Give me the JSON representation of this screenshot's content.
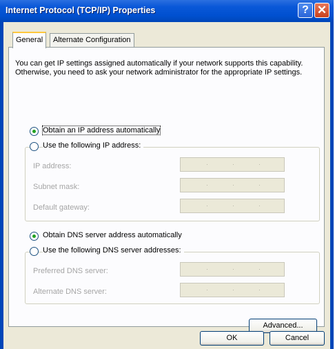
{
  "window": {
    "title": "Internet Protocol (TCP/IP) Properties",
    "help_glyph": "?",
    "close_glyph": "✕"
  },
  "tabs": [
    {
      "label": "General",
      "selected": true
    },
    {
      "label": "Alternate Configuration",
      "selected": false
    }
  ],
  "description": "You can get IP settings assigned automatically if your network supports this capability. Otherwise, you need to ask your network administrator for the appropriate IP settings.",
  "ip_section": {
    "obtain_auto": {
      "label": "Obtain an IP address automatically",
      "checked": true
    },
    "use_following": {
      "label": "Use the following IP address:",
      "checked": false
    },
    "fields": [
      {
        "label": "IP address:"
      },
      {
        "label": "Subnet mask:"
      },
      {
        "label": "Default gateway:"
      }
    ]
  },
  "dns_section": {
    "obtain_auto": {
      "label": "Obtain DNS server address automatically",
      "checked": true
    },
    "use_following": {
      "label": "Use the following DNS server addresses:",
      "checked": false
    },
    "fields": [
      {
        "label": "Preferred DNS server:"
      },
      {
        "label": "Alternate DNS server:"
      }
    ]
  },
  "buttons": {
    "advanced": "Advanced...",
    "ok": "OK",
    "cancel": "Cancel"
  },
  "colors": {
    "titlebar": "#0a58d8",
    "dialog_bg": "#ece9d8",
    "radio_dot": "#21a121",
    "disabled_text": "#a5a5a5"
  }
}
